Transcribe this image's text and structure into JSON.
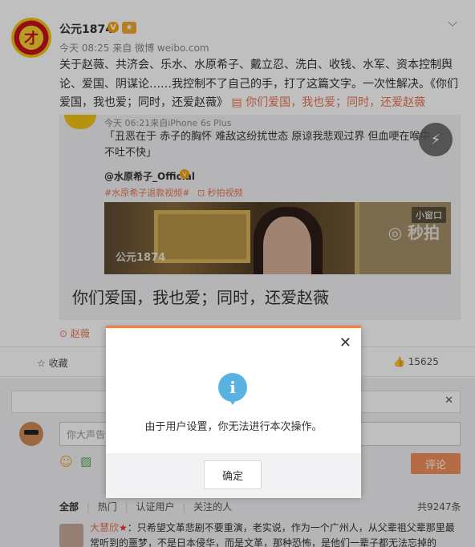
{
  "post": {
    "author": "公元1874",
    "verified_icon": "v-badge-icon",
    "medal_icon": "medal-icon",
    "time": "今天 08:25",
    "source_prefix": "来自",
    "source": "微博 weibo.com",
    "text": "关于赵薇、共济会、乐水、水原希子、戴立忍、洗白、收钱、水军、资本控制舆论、爱国、阴谋论……我控制不了自己的手，打了这篇文字。一次性解决。《你们爱国，我也爱；同时，还爱赵薇》",
    "link_text": "你们爱国，我也爱；同时，还爱赵薇",
    "location": "赵薇"
  },
  "repost": {
    "time": "今天 06:21来自iPhone 6s Plus",
    "quote": "「丑恶在于 赤子的胸怀 难敌这纷扰世态 原谅我悲观过界 但血哽在喉中 不吐不快」",
    "quoted_author": "@水原希子_Official",
    "tags": [
      "#水原希子退款视频#",
      "秒拍视频"
    ],
    "video_small_window": "小窗口",
    "video_brand": "秒拍",
    "video_watermark": "公元1874",
    "headline": "你们爱国，我也爱；同时，还爱赵薇"
  },
  "actions": {
    "favorite": "收藏",
    "likes": "15625"
  },
  "comment": {
    "placeholder": "你大声告诉",
    "submit": "评论",
    "tabs": [
      "全部",
      "热门",
      "认证用户",
      "关注的人"
    ],
    "total": "共9247条",
    "first_user": "大慧欣",
    "first_text": "：只希望文革悲剧不要重演，老实说，作为一个广州人，从父辈祖父辈那里最常听到的噩梦，不是日本侵华，而是文革，那种恐怖，是他们一辈子都无法忘掉的"
  },
  "dialog": {
    "message": "由于用户设置，你无法进行本次操作。",
    "ok": "确定",
    "close_icon": "close-icon",
    "info_icon": "info-icon"
  }
}
